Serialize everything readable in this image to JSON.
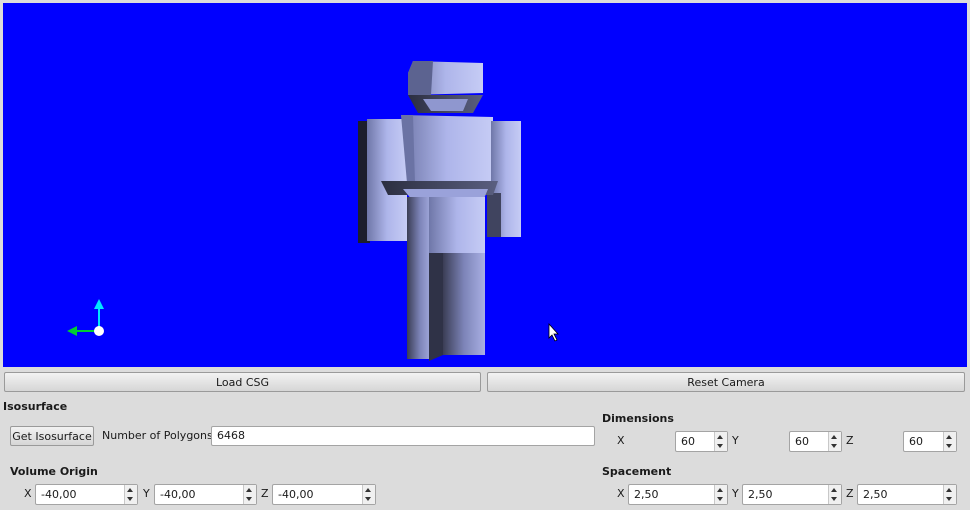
{
  "buttons": {
    "load_csg": "Load CSG",
    "reset_camera": "Reset Camera",
    "get_isosurface": "Get Isosurface"
  },
  "isosurface": {
    "heading": "Isosurface",
    "polygons_label": "Number of Polygons",
    "polygons_value": "6468"
  },
  "volume_origin": {
    "heading": "Volume Origin",
    "x_label": "X",
    "x": "-40,00",
    "y_label": "Y",
    "y": "-40,00",
    "z_label": "Z",
    "z": "-40,00"
  },
  "dimensions": {
    "heading": "Dimensions",
    "x_label": "X",
    "x": "60",
    "y_label": "Y",
    "y": "60",
    "z_label": "Z",
    "z": "60"
  },
  "spacement": {
    "heading": "Spacement",
    "x_label": "X",
    "x": "2,50",
    "y_label": "Y",
    "y": "2,50",
    "z_label": "Z",
    "z": "2,50"
  },
  "colors": {
    "viewport_bg": "#0000ff",
    "model": "#a8b0e8",
    "axis_y": "#00e5ff",
    "axis_x": "#00cc33"
  }
}
